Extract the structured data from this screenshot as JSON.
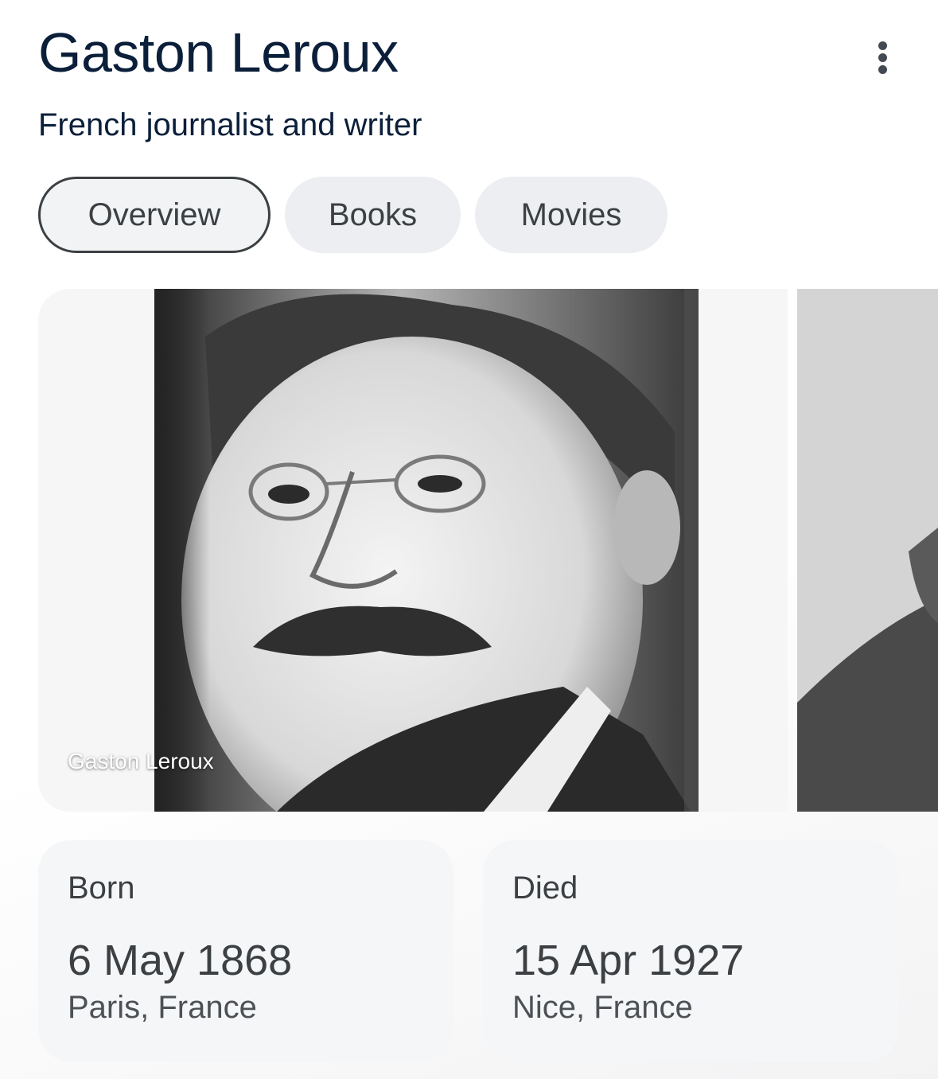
{
  "entity": {
    "title": "Gaston Leroux",
    "subtitle": "French journalist and writer",
    "menu_icon": "more-vert-icon"
  },
  "tabs": [
    {
      "label": "Overview",
      "active": true
    },
    {
      "label": "Books",
      "active": false
    },
    {
      "label": "Movies",
      "active": false
    }
  ],
  "gallery": {
    "main_caption": "Gaston Leroux"
  },
  "facts": {
    "born": {
      "label": "Born",
      "date": "6 May 1868",
      "place": "Paris, France"
    },
    "died": {
      "label": "Died",
      "date": "15 Apr 1927",
      "place": "Nice, France"
    }
  },
  "colors": {
    "title": "#0b1f3a",
    "chip_bg": "#eceef1",
    "chip_border_active": "#3c4043",
    "card_bg": "#f5f6f8"
  }
}
